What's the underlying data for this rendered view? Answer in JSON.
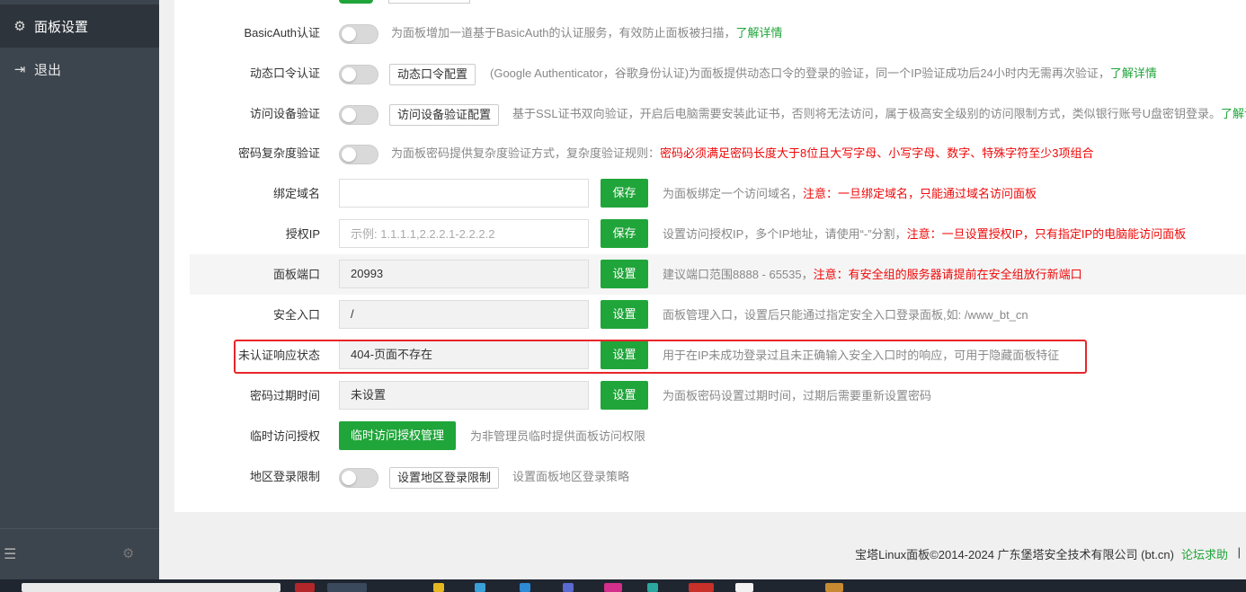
{
  "sidebar": {
    "items": [
      {
        "label": "面板设置",
        "icon": "gear-icon"
      },
      {
        "label": "退出",
        "icon": "logout-icon"
      }
    ],
    "bottom_icons": [
      "collapse-menu-icon",
      "settings-gear-icon"
    ]
  },
  "settings": {
    "basic_auth": {
      "label": "BasicAuth认证",
      "desc": "为面板增加一道基于BasicAuth的认证服务，有效防止面板被扫描，",
      "link": "了解详情"
    },
    "dynamic_pwd": {
      "label": "动态口令认证",
      "button": "动态口令配置",
      "desc": "(Google Authenticator，谷歌身份认证)为面板提供动态口令的登录的验证，同一个IP验证成功后24小时内无需再次验证，",
      "link": "了解详情"
    },
    "device_verify": {
      "label": "访问设备验证",
      "button": "访问设备验证配置",
      "desc": "基于SSL证书双向验证，开启后电脑需要安装此证书，否则将无法访问，属于极高安全级别的访问限制方式，类似银行账号U盘密钥登录。",
      "link": "了解详"
    },
    "pwd_complexity": {
      "label": "密码复杂度验证",
      "desc": "为面板密码提供复杂度验证方式，复杂度验证规则：",
      "warn": "密码必须满足密码长度大于8位且大写字母、小写字母、数字、特殊字符至少3项组合"
    },
    "bind_domain": {
      "label": "绑定域名",
      "value": "",
      "button": "保存",
      "desc": "为面板绑定一个访问域名，",
      "warn": "注意：一旦绑定域名，只能通过域名访问面板"
    },
    "auth_ip": {
      "label": "授权IP",
      "placeholder": "示例: 1.1.1.1,2.2.2.1-2.2.2.2",
      "button": "保存",
      "desc": "设置访问授权IP，多个IP地址，请使用“-”分割，",
      "warn": "注意：一旦设置授权IP，只有指定IP的电脑能访问面板"
    },
    "panel_port": {
      "label": "面板端口",
      "value": "20993",
      "button": "设置",
      "desc": "建议端口范围8888 - 65535，",
      "warn": "注意：有安全组的服务器请提前在安全组放行新端口"
    },
    "security_entry": {
      "label": "安全入口",
      "value": "/",
      "button": "设置",
      "desc": "面板管理入口，设置后只能通过指定安全入口登录面板,如: /www_bt_cn"
    },
    "unauth_response": {
      "label": "未认证响应状态",
      "value": "404-页面不存在",
      "button": "设置",
      "desc": "用于在IP未成功登录过且未正确输入安全入口时的响应，可用于隐藏面板特征"
    },
    "pwd_expire": {
      "label": "密码过期时间",
      "value": "未设置",
      "button": "设置",
      "desc": "为面板密码设置过期时间，过期后需要重新设置密码"
    },
    "temp_auth": {
      "label": "临时访问授权",
      "button": "临时访问授权管理",
      "desc": "为非管理员临时提供面板访问权限"
    },
    "region_limit": {
      "label": "地区登录限制",
      "button": "设置地区登录限制",
      "desc": "设置面板地区登录策略"
    }
  },
  "footer": {
    "copyright": "宝塔Linux面板©2014-2024 广东堡塔安全技术有限公司 (bt.cn)",
    "forum": "论坛求助",
    "separator": "|"
  },
  "colors": {
    "sidebar_bg": "#3c444d",
    "accent_green": "#20a53a",
    "warn_red": "#ef0808",
    "highlight_border": "#e8262a"
  }
}
